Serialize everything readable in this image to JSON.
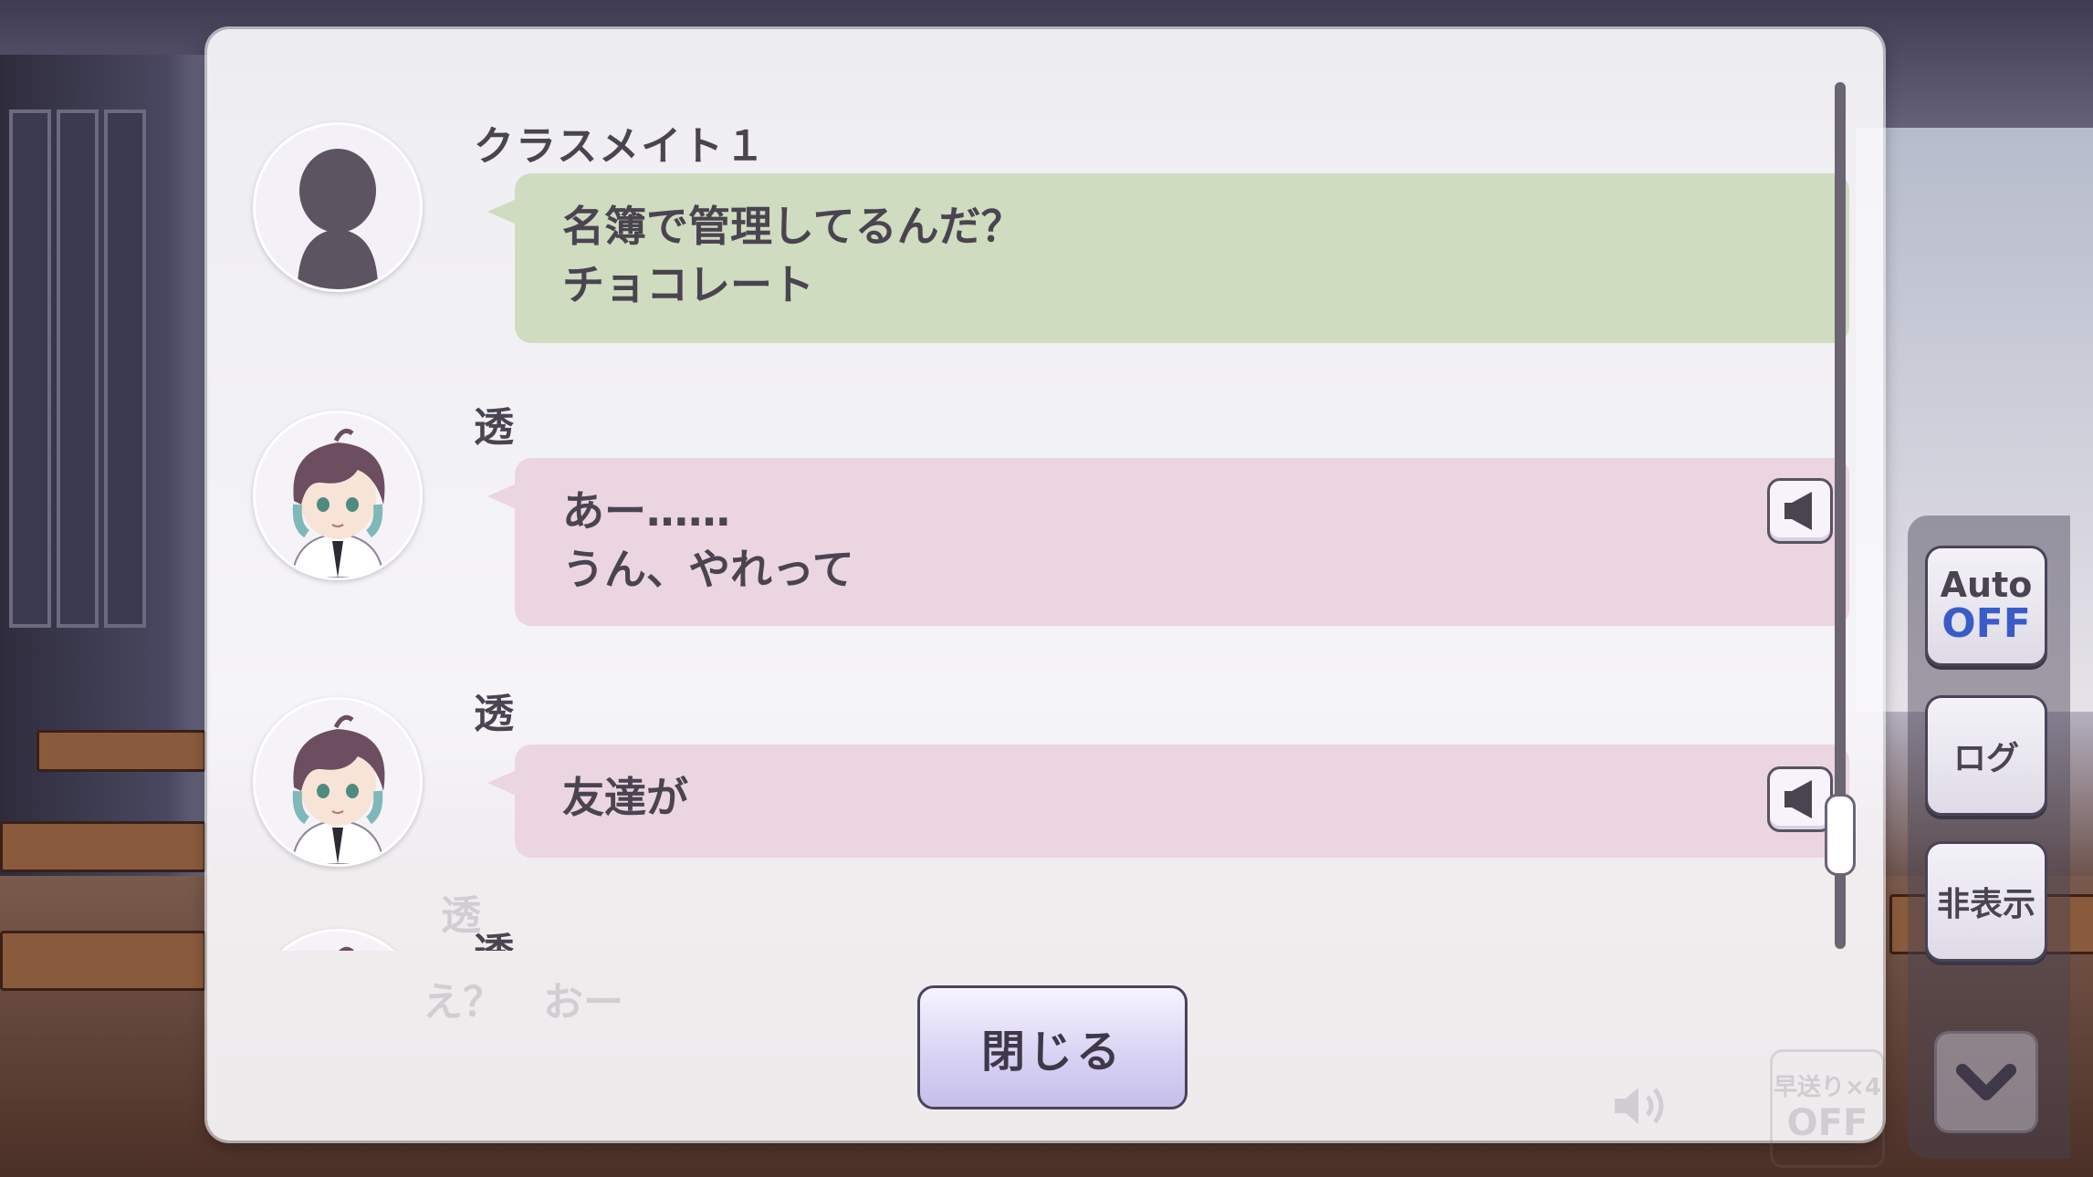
{
  "entries": [
    {
      "speaker": "クラスメイト１",
      "lines": [
        "名簿で管理してるんだ？",
        "チョコレート"
      ],
      "avatar_icon": "silhouette-icon",
      "bubble_color": "#cfdcbf",
      "has_voice": false
    },
    {
      "speaker": "透",
      "lines": [
        "あー……",
        "うん、やれって"
      ],
      "avatar_icon": "character-avatar",
      "bubble_color": "#ead5e0",
      "has_voice": true
    },
    {
      "speaker": "透",
      "lines": [
        "友達が"
      ],
      "avatar_icon": "character-avatar",
      "bubble_color": "#ead5e0",
      "has_voice": true
    },
    {
      "speaker": "透",
      "lines": [],
      "avatar_icon": "character-avatar",
      "bubble_color": "#ead5e0",
      "has_voice": false
    }
  ],
  "close_label": "閉じる",
  "background_text": {
    "line": "え？　おー",
    "speaker": "透",
    "fast_forward": "早送り×4",
    "fast_forward_state": "OFF"
  },
  "side_buttons": {
    "auto_label": "Auto",
    "auto_state": "OFF",
    "log_label": "ログ",
    "hide_label": "非表示"
  },
  "icons": {
    "voice": "speaker-icon",
    "down": "chevron-down-icon",
    "volume": "volume-icon"
  },
  "colors": {
    "accent_blue": "#3a5cc8",
    "green_bubble": "#cfdcbf",
    "pink_bubble": "#ead5e0"
  }
}
